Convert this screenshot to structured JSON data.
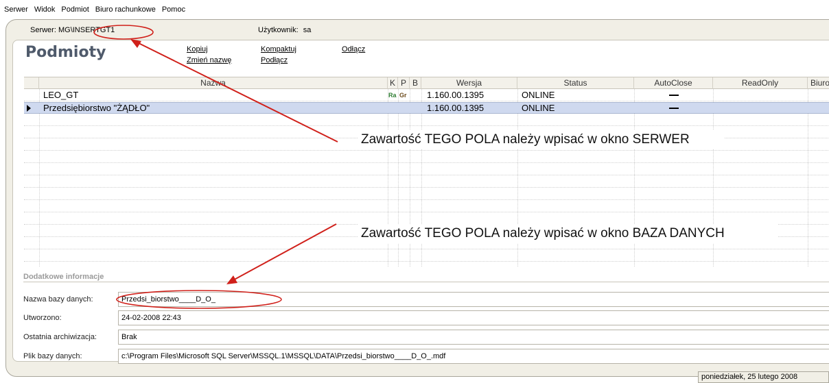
{
  "menu": [
    {
      "label": "Serwer"
    },
    {
      "label": "Widok"
    },
    {
      "label": "Podmiot"
    },
    {
      "label": "Biuro rachunkowe"
    },
    {
      "label": "Pomoc"
    }
  ],
  "server": {
    "label": "Serwer:",
    "value": "MG\\INSERTGT1"
  },
  "user": {
    "label": "Użytkownik:",
    "value": "sa"
  },
  "page_title": "Podmioty",
  "actions": {
    "kopiuj": "Kopiuj",
    "zmien_nazwe": "Zmień nazwę",
    "kompaktuj": "Kompaktuj",
    "podlacz": "Podłącz",
    "odlacz": "Odłącz"
  },
  "grid": {
    "columns": [
      "Nazwa",
      "K",
      "P",
      "B",
      "Wersja",
      "Status",
      "AutoClose",
      "ReadOnly",
      "Biuro"
    ],
    "rows": [
      {
        "nazwa": "LEO_GT",
        "k": "Ra",
        "p": "Gr",
        "wersja": "1.160.00.1395",
        "status": "ONLINE",
        "autoclose": "—"
      },
      {
        "nazwa": "Przedsiębiorstwo \"ŻĄDŁO\"",
        "k": "",
        "p": "",
        "wersja": "1.160.00.1395",
        "status": "ONLINE",
        "autoclose": "—"
      }
    ]
  },
  "notes": {
    "serwer": "Zawartość TEGO POLA należy wpisać w okno SERWER",
    "baza": "Zawartość TEGO POLA należy wpisać w okno BAZA DANYCH"
  },
  "info": {
    "section_title": "Dodatkowe informacje",
    "fields": [
      {
        "label": "Nazwa bazy danych:",
        "value": "Przedsi_biorstwo____D_O_"
      },
      {
        "label": "Utworzono:",
        "value": "24-02-2008 22:43"
      },
      {
        "label": "Ostatnia archiwizacja:",
        "value": "Brak"
      },
      {
        "label": "Plik bazy danych:",
        "value": "c:\\Program Files\\Microsoft SQL Server\\MSSQL.1\\MSSQL\\DATA\\Przedsi_biorstwo____D_O_.mdf"
      }
    ]
  },
  "status_date": "poniedziałek, 25 lutego 2008",
  "colors": {
    "selection": "#cfd9ef",
    "annotation_red": "#d0201a",
    "frame": "#f1efe6",
    "title": "#4f5a6b"
  }
}
